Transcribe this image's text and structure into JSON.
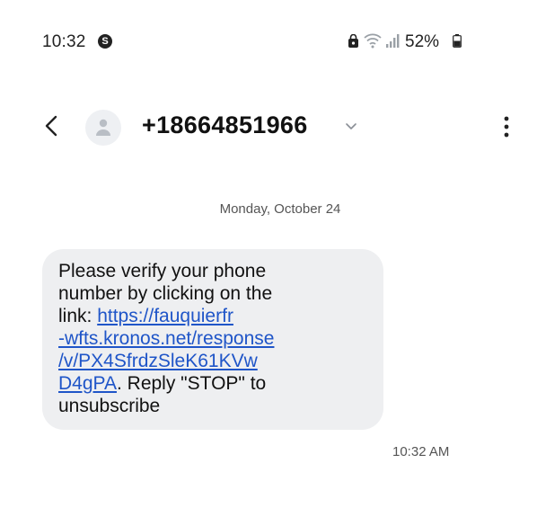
{
  "status_bar": {
    "time": "10:32",
    "notification_badge": "S",
    "battery_percent": "52%",
    "icons": [
      "lock-icon",
      "wifi-icon",
      "signal-icon",
      "battery-icon"
    ]
  },
  "header": {
    "contact": "+18664851966",
    "icons": [
      "back-arrow-icon",
      "avatar-icon",
      "chevron-down-icon",
      "more-options-icon"
    ]
  },
  "conversation": {
    "date": "Monday, October 24",
    "message": {
      "line1": "Please verify your phone",
      "line2": "number by clicking on the",
      "line3_prefix": "link: ",
      "link_line1": "https://fauquierfr",
      "link_line2": "-wfts.kronos.net/response",
      "link_line3": "/v/PX4SfrdzSleK61KVw",
      "link_line4": "D4gPA",
      "line7_suffix": ". Reply \"STOP\" to",
      "line8": "unsubscribe",
      "time": "10:32 AM"
    }
  },
  "colors": {
    "bubble_background": "#eeeff1",
    "link": "#1f55c8",
    "text": "#111111",
    "secondary_text": "#555555"
  }
}
